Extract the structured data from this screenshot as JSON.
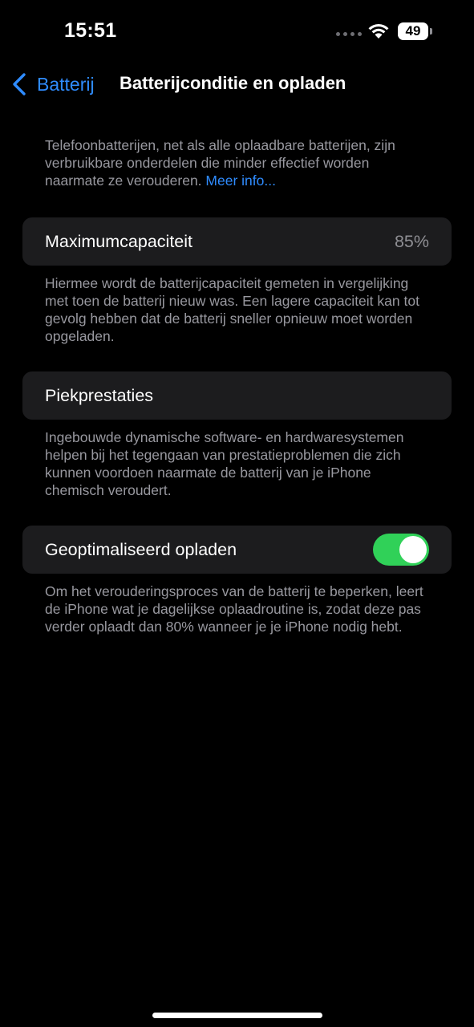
{
  "status_bar": {
    "time": "15:51",
    "battery_level": "49",
    "icons": [
      "signal-dots-icon",
      "wifi-icon",
      "battery-icon"
    ]
  },
  "nav": {
    "back_label": "Batterij",
    "title": "Batterijconditie en opladen"
  },
  "intro": {
    "text": "Telefoonbatterijen, net als alle oplaadbare batterijen, zijn verbruikbare onderdelen die minder effectief worden naarmate ze verouderen.",
    "link": "Meer info..."
  },
  "max_capacity": {
    "label": "Maximumcapaciteit",
    "value": "85%",
    "footnote": "Hiermee wordt de batterijcapaciteit gemeten in vergelijking met toen de batterij nieuw was. Een lagere capaciteit kan tot gevolg hebben dat de batterij sneller opnieuw moet worden opgeladen."
  },
  "peak_performance": {
    "label": "Piekprestaties",
    "footnote": "Ingebouwde dynamische software- en hardwaresystemen helpen bij het tegengaan van prestatieproblemen die zich kunnen voordoen naarmate de batterij van je iPhone chemisch veroudert."
  },
  "optimized_charging": {
    "label": "Geoptimaliseerd opladen",
    "enabled": true,
    "footnote": "Om het verouderingsproces van de batterij te beperken, leert de iPhone wat je dagelijkse oplaadroutine is, zodat deze pas verder oplaadt dan 80% wanneer je je iPhone nodig hebt."
  },
  "colors": {
    "background": "#000000",
    "cell_background": "#1c1c1e",
    "accent": "#2f8cff",
    "toggle_on": "#30d158",
    "secondary_text": "#98989f"
  }
}
